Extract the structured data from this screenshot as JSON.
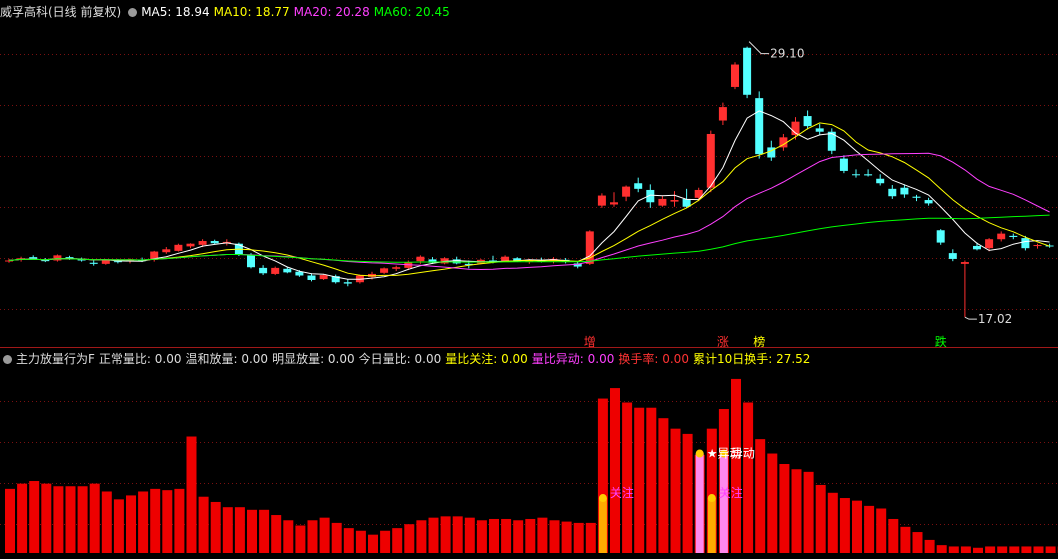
{
  "top_header": {
    "title": "威孚高科(日线 前复权)",
    "ma_items": [
      {
        "label": "MA5: 18.94",
        "color": "#ffffff"
      },
      {
        "label": "MA10: 18.77",
        "color": "#ffff00"
      },
      {
        "label": "MA20: 20.28",
        "color": "#ff40ff"
      },
      {
        "label": "MA60: 20.45",
        "color": "#00ff00"
      }
    ]
  },
  "bottom_header": {
    "title": "主力放量行为F",
    "items": [
      {
        "label": "正常量比: 0.00",
        "color": "#dddddd"
      },
      {
        "label": "温和放量: 0.00",
        "color": "#dddddd"
      },
      {
        "label": "明显放量: 0.00",
        "color": "#dddddd"
      },
      {
        "label": "今日量比: 0.00",
        "color": "#dddddd"
      },
      {
        "label": "量比关注: 0.00",
        "color": "#ffff00"
      },
      {
        "label": "量比异动: 0.00",
        "color": "#ff40ff"
      },
      {
        "label": "换手率: 0.00",
        "color": "#ff3333"
      },
      {
        "label": "累计10日换手: 27.52",
        "color": "#ffff00"
      }
    ]
  },
  "colors": {
    "up": "#ff3030",
    "down": "#54ffff",
    "ma5": "#ffffff",
    "ma10": "#ffff00",
    "ma20": "#ff40ff",
    "ma60": "#00ff00",
    "grid": "#7a1010",
    "volume": "#ee0000",
    "focus_bar": "#ffaa00",
    "anomaly_bar": "#ff88ee"
  },
  "chart_data": [
    {
      "type": "candlestick",
      "name": "price",
      "ylim": [
        16.0,
        30.2
      ],
      "annotations": {
        "high": "29.10",
        "low": "17.02"
      },
      "markers": [
        {
          "index": 48,
          "text": "增",
          "color": "#ff3030",
          "bg": "#000000"
        },
        {
          "index": 59,
          "text": "涨",
          "color": "#ff3030",
          "bg": "#000000"
        },
        {
          "index": 62,
          "text": "榜",
          "color": "#ffff00",
          "bg": "#000000"
        },
        {
          "index": 77,
          "text": "跌",
          "color": "#00ff00",
          "bg": "#000000"
        }
      ],
      "ohlc": [
        [
          19.55,
          19.62,
          19.45,
          19.55
        ],
        [
          19.6,
          19.72,
          19.5,
          19.65
        ],
        [
          19.7,
          19.78,
          19.58,
          19.62
        ],
        [
          19.6,
          19.66,
          19.48,
          19.52
        ],
        [
          19.55,
          19.82,
          19.5,
          19.78
        ],
        [
          19.7,
          19.76,
          19.58,
          19.62
        ],
        [
          19.6,
          19.68,
          19.5,
          19.55
        ],
        [
          19.45,
          19.55,
          19.32,
          19.4
        ],
        [
          19.4,
          19.62,
          19.36,
          19.58
        ],
        [
          19.52,
          19.62,
          19.42,
          19.5
        ],
        [
          19.52,
          19.64,
          19.42,
          19.58
        ],
        [
          19.58,
          19.68,
          19.48,
          19.52
        ],
        [
          19.58,
          19.98,
          19.5,
          19.95
        ],
        [
          19.92,
          20.15,
          19.85,
          20.05
        ],
        [
          19.98,
          20.3,
          19.95,
          20.25
        ],
        [
          20.18,
          20.32,
          20.1,
          20.3
        ],
        [
          20.25,
          20.5,
          20.15,
          20.42
        ],
        [
          20.42,
          20.48,
          20.28,
          20.32
        ],
        [
          20.32,
          20.5,
          20.22,
          20.38
        ],
        [
          20.3,
          20.35,
          19.75,
          19.82
        ],
        [
          19.8,
          19.88,
          19.2,
          19.25
        ],
        [
          19.22,
          19.34,
          18.9,
          18.98
        ],
        [
          18.95,
          19.28,
          18.9,
          19.22
        ],
        [
          19.18,
          19.26,
          18.98,
          19.02
        ],
        [
          19.05,
          19.12,
          18.82,
          18.88
        ],
        [
          18.88,
          18.98,
          18.62,
          18.68
        ],
        [
          18.72,
          18.95,
          18.68,
          18.9
        ],
        [
          18.85,
          18.92,
          18.52,
          18.58
        ],
        [
          18.58,
          18.7,
          18.4,
          18.52
        ],
        [
          18.58,
          18.92,
          18.52,
          18.88
        ],
        [
          18.82,
          19.05,
          18.7,
          18.95
        ],
        [
          19.0,
          19.24,
          18.95,
          19.2
        ],
        [
          19.18,
          19.32,
          19.08,
          19.25
        ],
        [
          19.22,
          19.55,
          19.12,
          19.48
        ],
        [
          19.52,
          19.78,
          19.4,
          19.72
        ],
        [
          19.6,
          19.7,
          19.4,
          19.45
        ],
        [
          19.42,
          19.7,
          19.38,
          19.65
        ],
        [
          19.6,
          19.72,
          19.38,
          19.42
        ],
        [
          19.4,
          19.55,
          19.2,
          19.35
        ],
        [
          19.42,
          19.62,
          19.38,
          19.58
        ],
        [
          19.55,
          19.76,
          19.42,
          19.5
        ],
        [
          19.52,
          19.78,
          19.48,
          19.72
        ],
        [
          19.65,
          19.7,
          19.48,
          19.52
        ],
        [
          19.48,
          19.62,
          19.4,
          19.58
        ],
        [
          19.55,
          19.68,
          19.46,
          19.52
        ],
        [
          19.52,
          19.7,
          19.42,
          19.62
        ],
        [
          19.58,
          19.66,
          19.42,
          19.48
        ],
        [
          19.42,
          19.5,
          19.2,
          19.28
        ],
        [
          19.4,
          20.9,
          19.35,
          20.85
        ],
        [
          22.0,
          22.55,
          21.9,
          22.45
        ],
        [
          22.05,
          22.6,
          21.95,
          22.15
        ],
        [
          22.4,
          22.9,
          22.2,
          22.85
        ],
        [
          23.0,
          23.25,
          22.6,
          22.75
        ],
        [
          22.7,
          22.95,
          21.9,
          22.15
        ],
        [
          22.0,
          22.45,
          21.95,
          22.3
        ],
        [
          22.18,
          22.65,
          21.95,
          22.25
        ],
        [
          22.3,
          22.75,
          21.9,
          21.95
        ],
        [
          22.35,
          22.8,
          22.2,
          22.7
        ],
        [
          22.8,
          25.35,
          22.6,
          25.2
        ],
        [
          25.8,
          26.6,
          25.6,
          26.4
        ],
        [
          27.3,
          28.4,
          27.2,
          28.3
        ],
        [
          29.05,
          29.1,
          26.8,
          26.95
        ],
        [
          26.8,
          27.1,
          24.1,
          24.3
        ],
        [
          24.6,
          24.9,
          24.0,
          24.15
        ],
        [
          24.6,
          25.2,
          24.45,
          25.05
        ],
        [
          25.15,
          25.95,
          24.95,
          25.75
        ],
        [
          26.0,
          26.25,
          25.4,
          25.55
        ],
        [
          25.45,
          25.65,
          25.15,
          25.3
        ],
        [
          25.3,
          25.45,
          24.3,
          24.45
        ],
        [
          24.1,
          24.25,
          23.45,
          23.55
        ],
        [
          23.4,
          23.62,
          23.25,
          23.38
        ],
        [
          23.4,
          23.62,
          23.3,
          23.35
        ],
        [
          23.2,
          23.4,
          22.9,
          23.0
        ],
        [
          22.75,
          22.92,
          22.3,
          22.42
        ],
        [
          22.8,
          22.95,
          22.35,
          22.5
        ],
        [
          22.4,
          22.48,
          22.2,
          22.35
        ],
        [
          22.25,
          22.35,
          22.0,
          22.1
        ],
        [
          20.9,
          20.95,
          20.25,
          20.35
        ],
        [
          19.88,
          20.05,
          19.52,
          19.62
        ],
        [
          19.4,
          19.55,
          17.02,
          19.48
        ],
        [
          20.2,
          20.35,
          20.0,
          20.05
        ],
        [
          20.1,
          20.55,
          19.96,
          20.5
        ],
        [
          20.5,
          20.85,
          20.4,
          20.75
        ],
        [
          20.65,
          20.75,
          20.5,
          20.6
        ],
        [
          20.55,
          20.65,
          20.0,
          20.1
        ],
        [
          20.2,
          20.3,
          20.08,
          20.24
        ],
        [
          20.22,
          20.3,
          20.12,
          20.2
        ]
      ],
      "ma_period_labels": [
        "MA5",
        "MA10",
        "MA20",
        "MA60"
      ]
    },
    {
      "type": "bar",
      "name": "main-force-volume",
      "values": [
        24.5,
        26.5,
        27.5,
        26.5,
        25.5,
        25.5,
        25.5,
        26.5,
        23.5,
        20.5,
        22,
        23.5,
        24.5,
        24,
        24.5,
        44.5,
        21.5,
        19.5,
        17.5,
        17.5,
        16.5,
        16.5,
        14.5,
        12.5,
        10.5,
        12.5,
        13.5,
        11.5,
        9.5,
        8.5,
        7,
        8.5,
        9.5,
        11,
        12.5,
        13.5,
        14,
        14,
        13.5,
        12.5,
        13,
        13,
        12.5,
        13,
        13.5,
        12.5,
        12,
        11.5,
        11.5,
        59,
        63,
        57.5,
        55.5,
        55.5,
        51.5,
        47.5,
        45.5,
        37.5,
        47.5,
        55,
        66.5,
        57.5,
        43.5,
        38,
        34,
        32,
        31,
        26,
        23,
        21,
        20,
        18,
        17,
        13,
        10,
        8,
        5,
        3,
        2.5,
        2.5,
        2,
        2.5,
        2.5,
        2.5,
        2.5,
        2.5,
        2.5,
        2.5
      ],
      "special_bars": [
        {
          "index": 49,
          "kind": "focus",
          "value": 21
        },
        {
          "index": 57,
          "kind": "anomaly",
          "value": 38
        },
        {
          "index": 58,
          "kind": "focus",
          "value": 21
        },
        {
          "index": 59,
          "kind": "anomaly",
          "value": 38
        }
      ],
      "labels": [
        {
          "index": 49,
          "text": "关注",
          "color": "#ff40ff",
          "value": 23
        },
        {
          "index": 58,
          "text": "关注",
          "color": "#ff40ff",
          "value": 23
        },
        {
          "index": 57,
          "text": "★异动",
          "color": "#ffffff",
          "value": 38
        },
        {
          "index": 59,
          "text": "异动",
          "color": "#ffffff",
          "value": 38
        }
      ],
      "ylim": [
        0,
        68
      ]
    }
  ]
}
